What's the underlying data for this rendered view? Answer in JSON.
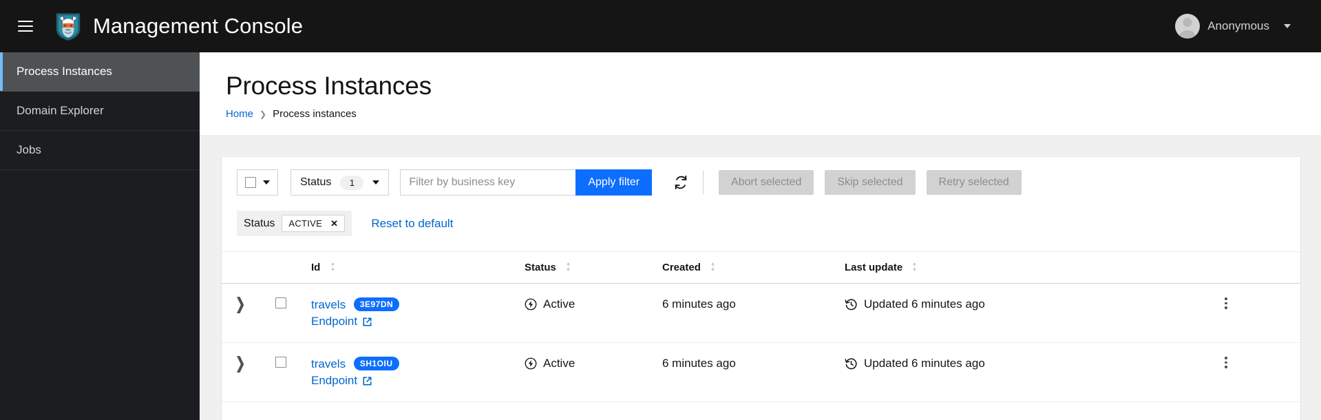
{
  "masthead": {
    "menu_icon": "hamburger-icon",
    "logo_icon": "kogito-mascot-logo",
    "title": "Management Console",
    "user": {
      "avatar_icon": "user-avatar-icon",
      "name": "Anonymous",
      "caret_icon": "caret-down-icon"
    }
  },
  "sidebar": {
    "items": [
      {
        "label": "Process Instances",
        "active": true
      },
      {
        "label": "Domain Explorer",
        "active": false
      },
      {
        "label": "Jobs",
        "active": false
      }
    ]
  },
  "page": {
    "title": "Process Instances",
    "breadcrumb": {
      "home": "Home",
      "separator": "›",
      "current": "Process instances"
    }
  },
  "toolbar": {
    "bulk_select": {
      "checkbox_icon": "checkbox-icon",
      "caret_icon": "caret-down-icon"
    },
    "status_filter": {
      "label": "Status",
      "count": "1",
      "caret_icon": "caret-down-icon"
    },
    "business_key": {
      "value": "",
      "placeholder": "Filter by business key"
    },
    "apply_filter_label": "Apply filter",
    "refresh_icon": "refresh-icon",
    "bulk_actions": [
      {
        "label": "Abort selected",
        "disabled": true
      },
      {
        "label": "Skip selected",
        "disabled": true
      },
      {
        "label": "Retry selected",
        "disabled": true
      }
    ]
  },
  "filter_chips": {
    "group_label": "Status",
    "chips": [
      {
        "label": "ACTIVE",
        "remove_icon": "close-icon"
      }
    ],
    "reset_label": "Reset to default"
  },
  "table": {
    "columns": [
      {
        "key": "id",
        "label": "Id",
        "sortable": true
      },
      {
        "key": "status",
        "label": "Status",
        "sortable": true
      },
      {
        "key": "created",
        "label": "Created",
        "sortable": true
      },
      {
        "key": "last_update",
        "label": "Last update",
        "sortable": true
      }
    ],
    "rows": [
      {
        "toggle_icon": "chevron-right-icon",
        "selected": false,
        "process_name": "travels",
        "business_key": "3E97DN",
        "endpoint_label": "Endpoint",
        "endpoint_icon": "external-link-icon",
        "status_icon": "on-running-icon",
        "status": "Active",
        "created": "6 minutes ago",
        "update_icon": "history-icon",
        "last_update": "Updated 6 minutes ago",
        "kebab_icon": "kebab-menu-icon"
      },
      {
        "toggle_icon": "chevron-right-icon",
        "selected": false,
        "process_name": "travels",
        "business_key": "SH1OIU",
        "endpoint_label": "Endpoint",
        "endpoint_icon": "external-link-icon",
        "status_icon": "on-running-icon",
        "status": "Active",
        "created": "6 minutes ago",
        "update_icon": "history-icon",
        "last_update": "Updated 6 minutes ago",
        "kebab_icon": "kebab-menu-icon"
      }
    ]
  },
  "colors": {
    "masthead_bg": "#151515",
    "sidebar_bg": "#1b1d21",
    "sidebar_active_bg": "#4f5255",
    "sidebar_active_accent": "#73bcf7",
    "primary_button": "#0d6efd",
    "link": "#0066cc",
    "badge": "#0d6efd",
    "disabled_button": "#d2d2d2"
  }
}
